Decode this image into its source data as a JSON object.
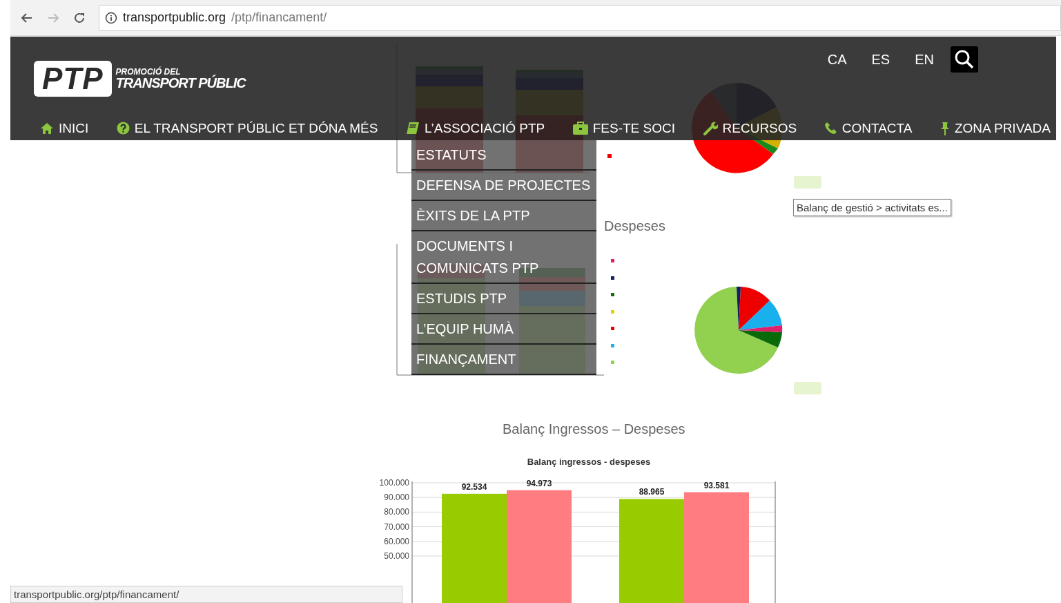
{
  "browser": {
    "url_host": "transportpublic.org",
    "url_path": "/ptp/financament/"
  },
  "header": {
    "logo": {
      "mark": "PTP",
      "line_1": "PROMOCIÓ DEL",
      "line_2": "TRANSPORT PÚBLIC"
    },
    "languages": [
      {
        "label": "CA"
      },
      {
        "label": "ES"
      },
      {
        "label": "EN"
      }
    ],
    "nav": [
      {
        "label": "INICI",
        "kind": "home"
      },
      {
        "label": "EL TRANSPORT PÚBLIC ET DÓNA MÉS",
        "kind": "question"
      },
      {
        "label": "L’ASSOCIACIÓ PTP",
        "kind": "book"
      },
      {
        "label": "FES-TE SOCI",
        "kind": "briefcase"
      },
      {
        "label": "RECURSOS",
        "kind": "wrench"
      },
      {
        "label": "CONTACTA",
        "kind": "phone"
      },
      {
        "label": "ZONA PRIVADA",
        "kind": "pin"
      }
    ]
  },
  "dropdown": {
    "items": [
      {
        "label": "ESTATUTS"
      },
      {
        "label": "DEFENSA DE PROJECTES"
      },
      {
        "label": "ÈXITS DE LA PTP"
      },
      {
        "label": "DOCUMENTS I COMUNICATS PTP"
      },
      {
        "label": "ESTUDIS PTP"
      },
      {
        "label": "L’EQUIP HUMÀ"
      },
      {
        "label": "FINANÇAMENT"
      }
    ]
  },
  "sections": [
    {
      "heading": "Despeses"
    },
    {
      "heading": "Balanç Ingressos – Despeses"
    }
  ],
  "balance_chart": {
    "chart_data": {
      "type": "bar",
      "title": "Balanç ingressos - despeses",
      "ylim": [
        0,
        100000
      ],
      "grid": true,
      "yticks": [
        {
          "value": 50000,
          "label": "50.000"
        },
        {
          "value": 60000,
          "label": "60.000"
        },
        {
          "value": 70000,
          "label": "70.000"
        },
        {
          "value": 80000,
          "label": "80.000"
        },
        {
          "value": 90000,
          "label": "90.000"
        },
        {
          "value": 100000,
          "label": "100.000"
        }
      ],
      "data_labels": true,
      "series": [
        {
          "color": "#99cc00",
          "values": [
            92534,
            88965
          ],
          "value_labels": [
            "92.534",
            "88.965"
          ]
        },
        {
          "color": "#ff7c80",
          "values": [
            94973,
            93581
          ],
          "value_labels": [
            "94.973",
            "93.581"
          ]
        }
      ]
    }
  },
  "tooltip": "Balanç de gestió > activitats es...",
  "status_bar": "transportpublic.org/ptp/financament/"
}
